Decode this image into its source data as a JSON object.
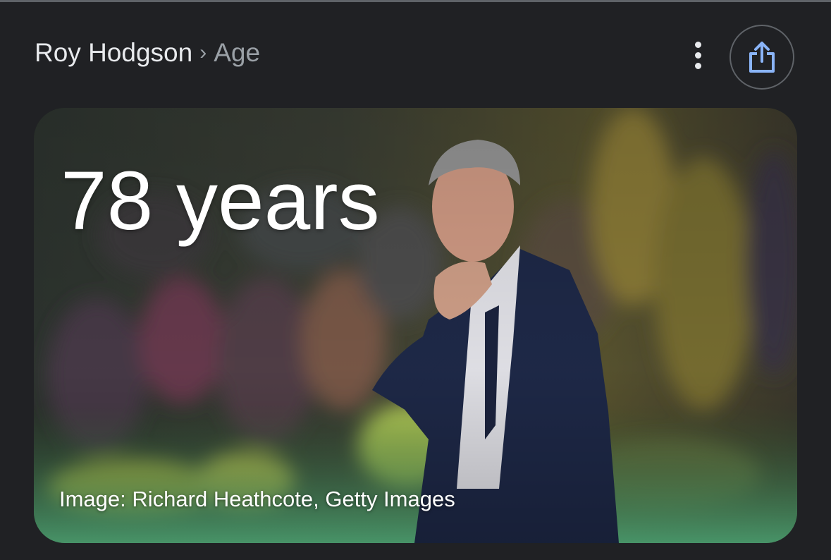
{
  "header": {
    "breadcrumb_entity": "Roy Hodgson",
    "breadcrumb_separator": "›",
    "breadcrumb_current": "Age"
  },
  "answer": {
    "age_text": "78 years"
  },
  "image": {
    "credit": "Image: Richard Heathcote, Getty Images",
    "subject": "man in navy suit with hand on chin at football stadium"
  },
  "icons": {
    "more": "more-vert-icon",
    "share": "share-icon"
  },
  "colors": {
    "background": "#202124",
    "text_primary": "#e8eaed",
    "text_secondary": "#9aa0a6",
    "share_icon": "#8ab4f8"
  }
}
